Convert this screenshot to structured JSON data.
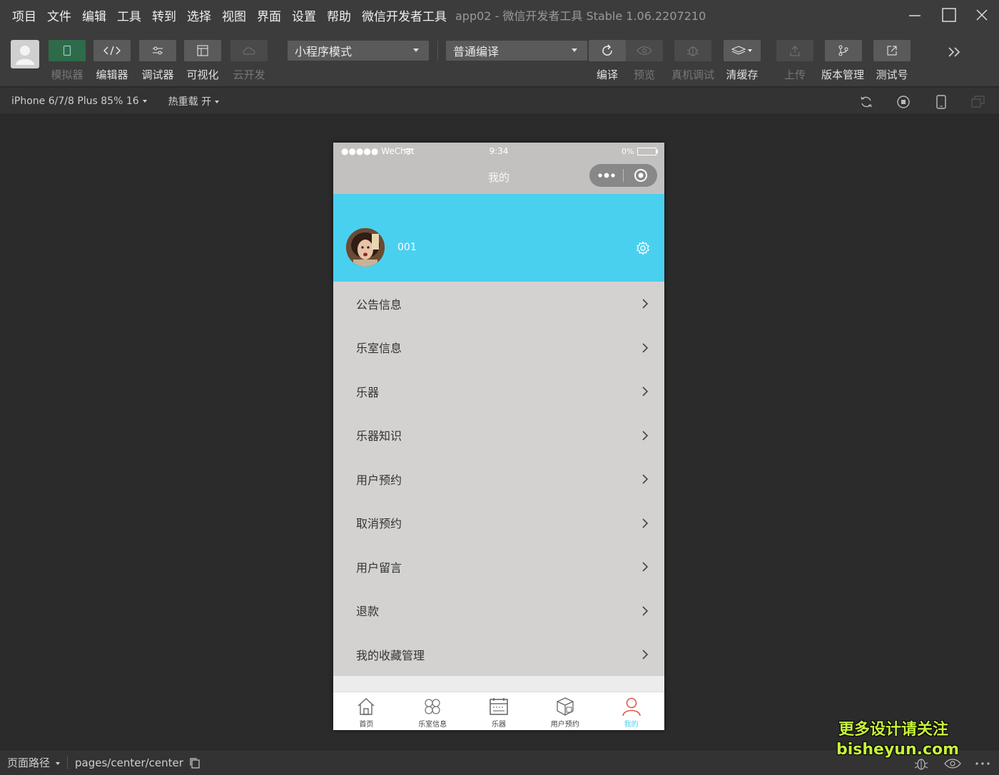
{
  "menubar": {
    "items": [
      "项目",
      "文件",
      "编辑",
      "工具",
      "转到",
      "选择",
      "视图",
      "界面",
      "设置",
      "帮助",
      "微信开发者工具"
    ],
    "app_title": "app02 - 微信开发者工具 Stable 1.06.2207210"
  },
  "toolbar": {
    "simulator": "模拟器",
    "editor": "编辑器",
    "debugger": "调试器",
    "visual": "可视化",
    "cloud": "云开发",
    "mode_select": "小程序模式",
    "compile_select": "普通编译",
    "compile": "编译",
    "preview": "预览",
    "device_debug": "真机调试",
    "clear_cache": "清缓存",
    "upload": "上传",
    "version": "版本管理",
    "test_account": "测试号"
  },
  "subbar": {
    "device": "iPhone 6/7/8 Plus 85% 16",
    "hot_reload": "热重载 开"
  },
  "phone": {
    "status": {
      "carrier": "●●●●● WeChat",
      "time": "9:34",
      "battery": "0%"
    },
    "nav_title": "我的",
    "username": "001",
    "menu": [
      "公告信息",
      "乐室信息",
      "乐器",
      "乐器知识",
      "用户预约",
      "取消预约",
      "用户留言",
      "退款",
      "我的收藏管理"
    ],
    "tabs": [
      "首页",
      "乐室信息",
      "乐器",
      "用户预约",
      "我的"
    ],
    "colors": {
      "header": "#4ad0ef",
      "active_tab": "#4ad0ef",
      "active_tab_icon": "#e05a4a"
    }
  },
  "bottombar": {
    "path_label": "页面路径",
    "path": "pages/center/center"
  },
  "watermark": {
    "line1": "更多设计请关注",
    "line2": "bisheyun.com"
  }
}
